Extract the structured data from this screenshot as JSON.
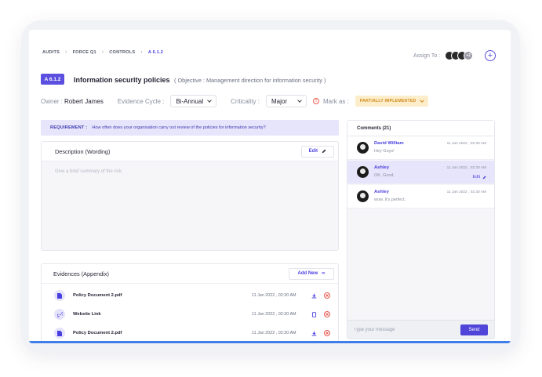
{
  "breadcrumb": [
    "AUDITS",
    "FORCE Q1",
    "CONTROLS",
    "A 6.1.2"
  ],
  "assign": {
    "label": "Assign To :",
    "more": "+2"
  },
  "control": {
    "id": "A 6.1.2",
    "title": "Information security policies",
    "objective": "( Objective : Management direction for information security )"
  },
  "meta": {
    "owner_label": "Owner :",
    "owner_value": "Robert James",
    "cycle_label": "Evidence Cycle :",
    "cycle_value": "Bi-Annual",
    "criticality_label": "Criticality :",
    "criticality_value": "Major",
    "mark_label": "Mark as :",
    "mark_value": "PARTIALLY IMPLEMENTED"
  },
  "requirement": {
    "label": "REQUIREMENT :",
    "text": "How often does your organisation carry out review of the policies for information security?"
  },
  "description": {
    "title": "Description (Wording)",
    "edit_label": "Edit",
    "placeholder": "Give a brief summary of the risk."
  },
  "evidences": {
    "title": "Evidences (Appendix)",
    "add_label": "Add New",
    "items": [
      {
        "name": "Policy Document 2.pdf",
        "date": "11 Jan 2022 , 02:30 AM",
        "type": "file"
      },
      {
        "name": "Website Link",
        "date": "11 Jan 2022 , 02:30 AM",
        "type": "link"
      },
      {
        "name": "Policy Document 2.pdf",
        "date": "11 Jan 2022 , 02:30 AM",
        "type": "file"
      }
    ]
  },
  "comments": {
    "title": "Comments (21)",
    "items": [
      {
        "name": "David William",
        "text": "Hey Guys!",
        "time": "11 Jan 2022 , 02:30 AM"
      },
      {
        "name": "Ashley",
        "text": "OK. Good.",
        "time": "11 Jan 2022 , 02:30 AM",
        "edit": "Edit"
      },
      {
        "name": "Ashley",
        "text": "wow. it's perfect.",
        "time": "11 Jan 2022 , 02:30 AM"
      }
    ],
    "input_placeholder": "Type your message",
    "send_label": "Send"
  },
  "colors": {
    "accent": "#5b4fe0",
    "status_bg": "#fdeecb",
    "status_text": "#d08a1a",
    "danger": "#e85a4f"
  }
}
